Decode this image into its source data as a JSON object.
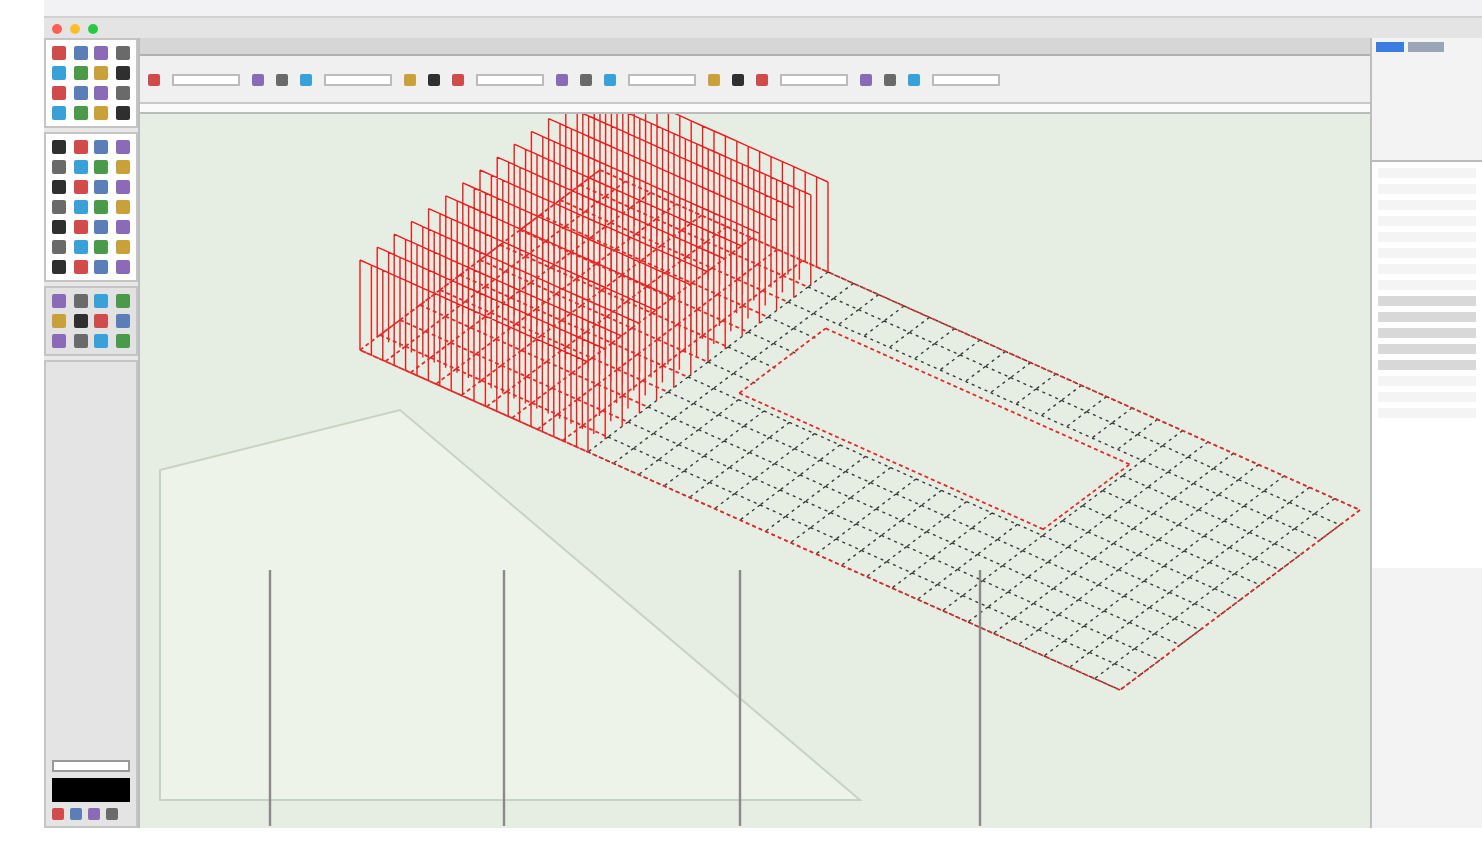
{
  "palettes": [
    {
      "kind": "tools"
    },
    {
      "kind": "tools"
    },
    {
      "kind": "swatches"
    },
    {
      "kind": "attributes"
    }
  ],
  "view": {
    "kind": "wireframe"
  },
  "info_panel": {
    "kind": "object-info"
  }
}
